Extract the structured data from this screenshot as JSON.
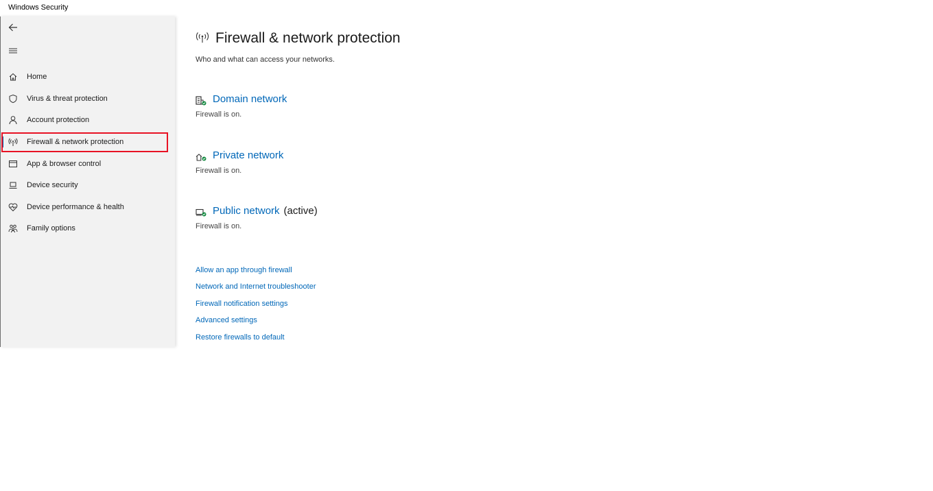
{
  "window": {
    "title": "Windows Security"
  },
  "sidebar": {
    "items": [
      {
        "label": "Home",
        "icon": "home-icon"
      },
      {
        "label": "Virus & threat protection",
        "icon": "shield-icon"
      },
      {
        "label": "Account protection",
        "icon": "person-icon"
      },
      {
        "label": "Firewall & network protection",
        "icon": "antenna-icon",
        "selected": true
      },
      {
        "label": "App & browser control",
        "icon": "browser-window-icon"
      },
      {
        "label": "Device security",
        "icon": "laptop-icon"
      },
      {
        "label": "Device performance & health",
        "icon": "heart-pulse-icon"
      },
      {
        "label": "Family options",
        "icon": "family-icon"
      }
    ]
  },
  "main": {
    "title": "Firewall & network protection",
    "subtitle": "Who and what can access your networks.",
    "networks": [
      {
        "name": "Domain network",
        "active_label": "",
        "status": "Firewall is on.",
        "icon": "domain-network-icon"
      },
      {
        "name": "Private network",
        "active_label": "",
        "status": "Firewall is on.",
        "icon": "private-network-icon"
      },
      {
        "name": "Public network",
        "active_label": "(active)",
        "status": "Firewall is on.",
        "icon": "public-network-icon"
      }
    ],
    "links": [
      "Allow an app through firewall",
      "Network and Internet troubleshooter",
      "Firewall notification settings",
      "Advanced settings",
      "Restore firewalls to default"
    ]
  },
  "colors": {
    "accent": "#0067b8",
    "highlight": "#e81123",
    "ok_green": "#10893e",
    "sidebar_bg": "#f2f2f2"
  }
}
